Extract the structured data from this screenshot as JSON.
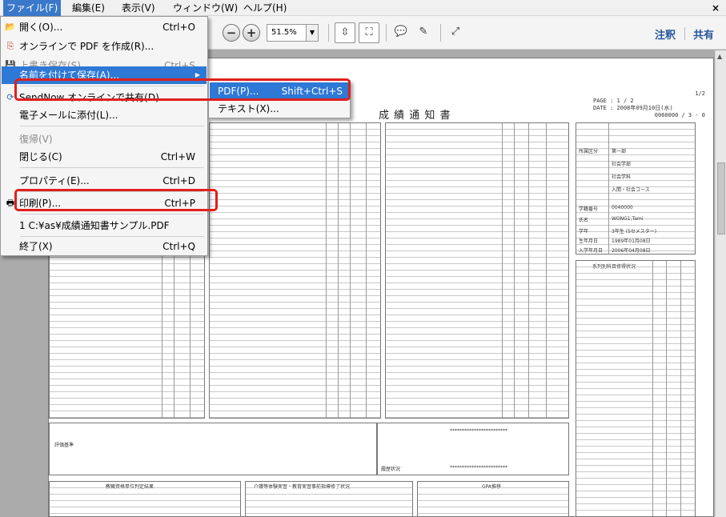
{
  "menubar": {
    "items": [
      "ファイル(F)",
      "編集(E)",
      "表示(V)",
      "ウィンドウ(W)",
      "ヘルプ(H)"
    ],
    "close": "×"
  },
  "toolbar": {
    "zoom": "51.5%",
    "comment": "注釈",
    "share": "共有"
  },
  "file_menu": {
    "items": [
      {
        "label": "開く(O)...",
        "shortcut": "Ctrl+O",
        "icon": "folder-open-icon"
      },
      {
        "label": "オンラインで PDF を作成(R)...",
        "shortcut": "",
        "icon": "create-pdf-icon"
      },
      {
        "label": "上書き保存(S)",
        "shortcut": "Ctrl+S",
        "icon": "save-icon"
      },
      {
        "label": "名前を付けて保存(A)...",
        "shortcut": "",
        "icon": ""
      },
      {
        "label": "SendNow オンラインで共有(D)...",
        "shortcut": "",
        "icon": "sendnow-icon"
      },
      {
        "label": "電子メールに添付(L)...",
        "shortcut": "",
        "icon": ""
      },
      {
        "label": "復帰(V)",
        "shortcut": "",
        "icon": ""
      },
      {
        "label": "閉じる(C)",
        "shortcut": "Ctrl+W",
        "icon": ""
      },
      {
        "label": "プロパティ(E)...",
        "shortcut": "Ctrl+D",
        "icon": ""
      },
      {
        "label": "印刷(P)...",
        "shortcut": "Ctrl+P",
        "icon": "printer-icon"
      },
      {
        "label": "1 C:¥as¥成績通知書サンプル.PDF",
        "shortcut": "",
        "icon": ""
      },
      {
        "label": "終了(X)",
        "shortcut": "Ctrl+Q",
        "icon": ""
      }
    ]
  },
  "save_as_submenu": {
    "items": [
      {
        "label": "PDF(P)...",
        "shortcut": "Shift+Ctrl+S"
      },
      {
        "label": "テキスト(X)...",
        "shortcut": ""
      }
    ]
  },
  "document": {
    "title": "成 績 通 知 書",
    "page_label": "PAGE :",
    "page_value": "1 / 2",
    "page_top": "1/2",
    "date_label": "DATE :",
    "date_value": "2008年09月10日(水)",
    "code": "0060000 / 3 - 0",
    "sidebar_labels": [
      "所属区分",
      "学籍番号",
      "氏名",
      "学年",
      "生年月日",
      "入学年月日",
      "系列別科目修得状況"
    ],
    "sidebar_values": [
      "第一部",
      "社会学部",
      "社会学科",
      "入間・社会コース",
      "0040000",
      "WONG1,Tami",
      "3年生 (5セメスター)",
      "1989年01月08日",
      "2006年04月08日"
    ],
    "footer_labels": [
      "教職資格単位判定結果",
      "介護等体験実習・教育実習事前指導修了状況",
      "GPA推移"
    ],
    "bottom_text": "履歴状況",
    "stars": "************************",
    "eval_label": "評価基準"
  }
}
